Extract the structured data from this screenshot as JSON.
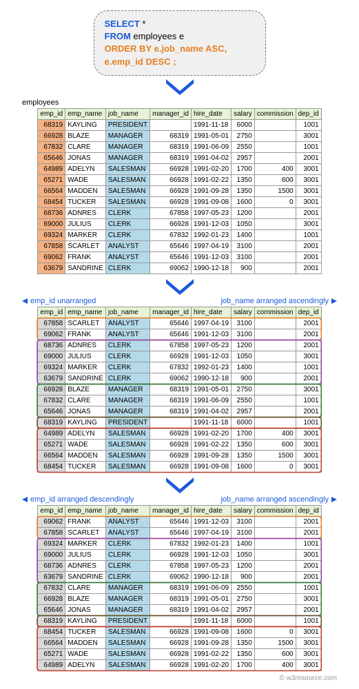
{
  "sql": {
    "line1a": "SELECT",
    "line1b": " *",
    "line2a": "FROM",
    "line2b": " employees e",
    "line3a": "ORDER BY",
    "line3b": " e.job_name ASC,",
    "line4": "e.emp_id DESC ;"
  },
  "table_name": "employees",
  "headers": [
    "emp_id",
    "emp_name",
    "job_name",
    "manager_id",
    "hire_date",
    "salary",
    "commission",
    "dep_id"
  ],
  "t1": [
    {
      "emp_id": "68319",
      "emp_name": "KAYLING",
      "job_name": "PRESIDENT",
      "manager_id": "",
      "hire_date": "1991-11-18",
      "salary": "6000",
      "commission": "",
      "dep_id": "1001"
    },
    {
      "emp_id": "66928",
      "emp_name": "BLAZE",
      "job_name": "MANAGER",
      "manager_id": "68319",
      "hire_date": "1991-05-01",
      "salary": "2750",
      "commission": "",
      "dep_id": "3001"
    },
    {
      "emp_id": "67832",
      "emp_name": "CLARE",
      "job_name": "MANAGER",
      "manager_id": "68319",
      "hire_date": "1991-06-09",
      "salary": "2550",
      "commission": "",
      "dep_id": "1001"
    },
    {
      "emp_id": "65646",
      "emp_name": "JONAS",
      "job_name": "MANAGER",
      "manager_id": "68319",
      "hire_date": "1991-04-02",
      "salary": "2957",
      "commission": "",
      "dep_id": "2001"
    },
    {
      "emp_id": "64989",
      "emp_name": "ADELYN",
      "job_name": "SALESMAN",
      "manager_id": "66928",
      "hire_date": "1991-02-20",
      "salary": "1700",
      "commission": "400",
      "dep_id": "3001"
    },
    {
      "emp_id": "65271",
      "emp_name": "WADE",
      "job_name": "SALESMAN",
      "manager_id": "66928",
      "hire_date": "1991-02-22",
      "salary": "1350",
      "commission": "600",
      "dep_id": "3001"
    },
    {
      "emp_id": "66564",
      "emp_name": "MADDEN",
      "job_name": "SALESMAN",
      "manager_id": "66928",
      "hire_date": "1991-09-28",
      "salary": "1350",
      "commission": "1500",
      "dep_id": "3001"
    },
    {
      "emp_id": "68454",
      "emp_name": "TUCKER",
      "job_name": "SALESMAN",
      "manager_id": "66928",
      "hire_date": "1991-09-08",
      "salary": "1600",
      "commission": "0",
      "dep_id": "3001"
    },
    {
      "emp_id": "68736",
      "emp_name": "ADNRES",
      "job_name": "CLERK",
      "manager_id": "67858",
      "hire_date": "1997-05-23",
      "salary": "1200",
      "commission": "",
      "dep_id": "2001"
    },
    {
      "emp_id": "69000",
      "emp_name": "JULIUS",
      "job_name": "CLERK",
      "manager_id": "66928",
      "hire_date": "1991-12-03",
      "salary": "1050",
      "commission": "",
      "dep_id": "3001"
    },
    {
      "emp_id": "69324",
      "emp_name": "MARKER",
      "job_name": "CLERK",
      "manager_id": "67832",
      "hire_date": "1992-01-23",
      "salary": "1400",
      "commission": "",
      "dep_id": "1001"
    },
    {
      "emp_id": "67858",
      "emp_name": "SCARLET",
      "job_name": "ANALYST",
      "manager_id": "65646",
      "hire_date": "1997-04-19",
      "salary": "3100",
      "commission": "",
      "dep_id": "2001"
    },
    {
      "emp_id": "69062",
      "emp_name": "FRANK",
      "job_name": "ANALYST",
      "manager_id": "65646",
      "hire_date": "1991-12-03",
      "salary": "3100",
      "commission": "",
      "dep_id": "2001"
    },
    {
      "emp_id": "63679",
      "emp_name": "SANDRINE",
      "job_name": "CLERK",
      "manager_id": "69062",
      "hire_date": "1990-12-18",
      "salary": "900",
      "commission": "",
      "dep_id": "2001"
    }
  ],
  "label_left1": "emp_id unarranged",
  "label_right1": "job_name arranged ascendingly",
  "t2": [
    {
      "emp_id": "67858",
      "emp_name": "SCARLET",
      "job_name": "ANALYST",
      "manager_id": "65646",
      "hire_date": "1997-04-19",
      "salary": "3100",
      "commission": "",
      "dep_id": "2001"
    },
    {
      "emp_id": "69062",
      "emp_name": "FRANK",
      "job_name": "ANALYST",
      "manager_id": "65646",
      "hire_date": "1991-12-03",
      "salary": "3100",
      "commission": "",
      "dep_id": "2001"
    },
    {
      "emp_id": "68736",
      "emp_name": "ADNRES",
      "job_name": "CLERK",
      "manager_id": "67858",
      "hire_date": "1997-05-23",
      "salary": "1200",
      "commission": "",
      "dep_id": "2001"
    },
    {
      "emp_id": "69000",
      "emp_name": "JULIUS",
      "job_name": "CLERK",
      "manager_id": "66928",
      "hire_date": "1991-12-03",
      "salary": "1050",
      "commission": "",
      "dep_id": "3001"
    },
    {
      "emp_id": "69324",
      "emp_name": "MARKER",
      "job_name": "CLERK",
      "manager_id": "67832",
      "hire_date": "1992-01-23",
      "salary": "1400",
      "commission": "",
      "dep_id": "1001"
    },
    {
      "emp_id": "63679",
      "emp_name": "SANDRINE",
      "job_name": "CLERK",
      "manager_id": "69062",
      "hire_date": "1990-12-18",
      "salary": "900",
      "commission": "",
      "dep_id": "2001"
    },
    {
      "emp_id": "66928",
      "emp_name": "BLAZE",
      "job_name": "MANAGER",
      "manager_id": "68319",
      "hire_date": "1991-05-01",
      "salary": "2750",
      "commission": "",
      "dep_id": "3001"
    },
    {
      "emp_id": "67832",
      "emp_name": "CLARE",
      "job_name": "MANAGER",
      "manager_id": "68319",
      "hire_date": "1991-06-09",
      "salary": "2550",
      "commission": "",
      "dep_id": "1001"
    },
    {
      "emp_id": "65646",
      "emp_name": "JONAS",
      "job_name": "MANAGER",
      "manager_id": "68319",
      "hire_date": "1991-04-02",
      "salary": "2957",
      "commission": "",
      "dep_id": "2001"
    },
    {
      "emp_id": "68319",
      "emp_name": "KAYLING",
      "job_name": "PRESIDENT",
      "manager_id": "",
      "hire_date": "1991-11-18",
      "salary": "6000",
      "commission": "",
      "dep_id": "1001"
    },
    {
      "emp_id": "64989",
      "emp_name": "ADELYN",
      "job_name": "SALESMAN",
      "manager_id": "66928",
      "hire_date": "1991-02-20",
      "salary": "1700",
      "commission": "400",
      "dep_id": "3001"
    },
    {
      "emp_id": "65271",
      "emp_name": "WADE",
      "job_name": "SALESMAN",
      "manager_id": "66928",
      "hire_date": "1991-02-22",
      "salary": "1350",
      "commission": "600",
      "dep_id": "3001"
    },
    {
      "emp_id": "66564",
      "emp_name": "MADDEN",
      "job_name": "SALESMAN",
      "manager_id": "66928",
      "hire_date": "1991-09-28",
      "salary": "1350",
      "commission": "1500",
      "dep_id": "3001"
    },
    {
      "emp_id": "68454",
      "emp_name": "TUCKER",
      "job_name": "SALESMAN",
      "manager_id": "66928",
      "hire_date": "1991-09-08",
      "salary": "1600",
      "commission": "0",
      "dep_id": "3001"
    }
  ],
  "label_left2": "emp_id arranged descendingly",
  "label_right2": "job_name arranged ascendingly",
  "t3": [
    {
      "emp_id": "69062",
      "emp_name": "FRANK",
      "job_name": "ANALYST",
      "manager_id": "65646",
      "hire_date": "1991-12-03",
      "salary": "3100",
      "commission": "",
      "dep_id": "2001"
    },
    {
      "emp_id": "67858",
      "emp_name": "SCARLET",
      "job_name": "ANALYST",
      "manager_id": "65646",
      "hire_date": "1997-04-19",
      "salary": "3100",
      "commission": "",
      "dep_id": "2001"
    },
    {
      "emp_id": "69324",
      "emp_name": "MARKER",
      "job_name": "CLERK",
      "manager_id": "67832",
      "hire_date": "1992-01-23",
      "salary": "1400",
      "commission": "",
      "dep_id": "1001"
    },
    {
      "emp_id": "69000",
      "emp_name": "JULIUS",
      "job_name": "CLERK",
      "manager_id": "66928",
      "hire_date": "1991-12-03",
      "salary": "1050",
      "commission": "",
      "dep_id": "3001"
    },
    {
      "emp_id": "68736",
      "emp_name": "ADNRES",
      "job_name": "CLERK",
      "manager_id": "67858",
      "hire_date": "1997-05-23",
      "salary": "1200",
      "commission": "",
      "dep_id": "2001"
    },
    {
      "emp_id": "63679",
      "emp_name": "SANDRINE",
      "job_name": "CLERK",
      "manager_id": "69062",
      "hire_date": "1990-12-18",
      "salary": "900",
      "commission": "",
      "dep_id": "2001"
    },
    {
      "emp_id": "67832",
      "emp_name": "CLARE",
      "job_name": "MANAGER",
      "manager_id": "68319",
      "hire_date": "1991-06-09",
      "salary": "2550",
      "commission": "",
      "dep_id": "1001"
    },
    {
      "emp_id": "66928",
      "emp_name": "BLAZE",
      "job_name": "MANAGER",
      "manager_id": "68319",
      "hire_date": "1991-05-01",
      "salary": "2750",
      "commission": "",
      "dep_id": "3001"
    },
    {
      "emp_id": "65646",
      "emp_name": "JONAS",
      "job_name": "MANAGER",
      "manager_id": "68319",
      "hire_date": "1991-04-02",
      "salary": "2957",
      "commission": "",
      "dep_id": "2001"
    },
    {
      "emp_id": "68319",
      "emp_name": "KAYLING",
      "job_name": "PRESIDENT",
      "manager_id": "",
      "hire_date": "1991-11-18",
      "salary": "6000",
      "commission": "",
      "dep_id": "1001"
    },
    {
      "emp_id": "68454",
      "emp_name": "TUCKER",
      "job_name": "SALESMAN",
      "manager_id": "66928",
      "hire_date": "1991-09-08",
      "salary": "1600",
      "commission": "0",
      "dep_id": "3001"
    },
    {
      "emp_id": "66564",
      "emp_name": "MADDEN",
      "job_name": "SALESMAN",
      "manager_id": "66928",
      "hire_date": "1991-09-28",
      "salary": "1350",
      "commission": "1500",
      "dep_id": "3001"
    },
    {
      "emp_id": "65271",
      "emp_name": "WADE",
      "job_name": "SALESMAN",
      "manager_id": "66928",
      "hire_date": "1991-02-22",
      "salary": "1350",
      "commission": "600",
      "dep_id": "3001"
    },
    {
      "emp_id": "64989",
      "emp_name": "ADELYN",
      "job_name": "SALESMAN",
      "manager_id": "66928",
      "hire_date": "1991-02-20",
      "salary": "1700",
      "commission": "400",
      "dep_id": "3001"
    }
  ],
  "footer": "© w3resource.com",
  "group_colors": {
    "analyst": "#e67e22",
    "clerk": "#8e44ad",
    "manager": "#2a7e2a",
    "president": "#6b4d2a",
    "salesman": "#c0392b"
  }
}
